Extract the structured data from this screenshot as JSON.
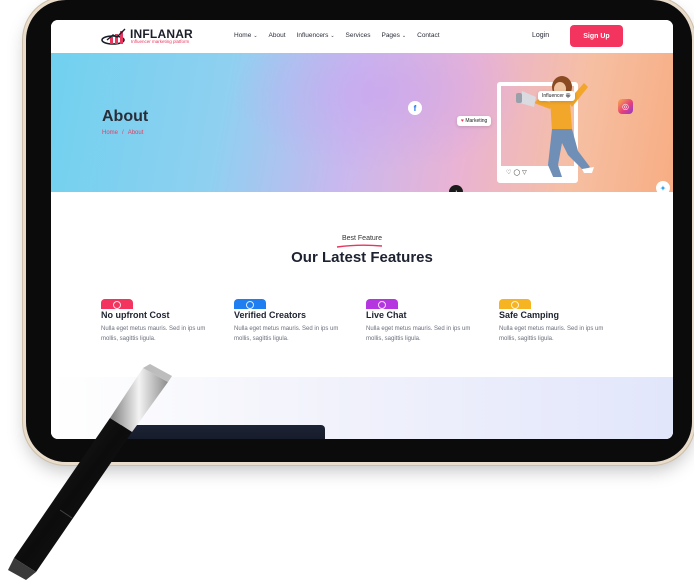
{
  "brand": {
    "name": "INFLANAR",
    "tagline": "Influencer marketing platform",
    "accent_color": "#f2345e"
  },
  "nav": {
    "items": [
      {
        "label": "Home",
        "has_dropdown": true
      },
      {
        "label": "About",
        "has_dropdown": false
      },
      {
        "label": "Influencers",
        "has_dropdown": true
      },
      {
        "label": "Services",
        "has_dropdown": false
      },
      {
        "label": "Pages",
        "has_dropdown": true
      },
      {
        "label": "Contact",
        "has_dropdown": false
      }
    ],
    "login_label": "Login",
    "signup_label": "Sign Up"
  },
  "hero": {
    "title": "About",
    "breadcrumb": {
      "home": "Home",
      "separator": "/",
      "current": "About"
    },
    "tag_influencer": "Influencer 😀",
    "tag_marketing": "Marketing",
    "social_icons": [
      "facebook-icon",
      "instagram-icon",
      "tiktok-icon",
      "twitter-icon"
    ]
  },
  "features_section": {
    "eyebrow": "Best Feature",
    "title": "Our Latest Features",
    "features": [
      {
        "title": "No upfront Cost",
        "text": "Nulla eget metus mauris. Sed in ips um mollis, sagittis ligula.",
        "color": "#f2345e",
        "icon": "dollar-icon"
      },
      {
        "title": "Verified Creators",
        "text": "Nulla eget metus mauris. Sed in ips um mollis, sagittis ligula.",
        "color": "#1f7ef0",
        "icon": "check-icon"
      },
      {
        "title": "Live Chat",
        "text": "Nulla eget metus mauris. Sed in ips um mollis, sagittis ligula.",
        "color": "#b536e0",
        "icon": "chat-icon"
      },
      {
        "title": "Safe Camping",
        "text": "Nulla eget metus mauris. Sed in ips um mollis, sagittis ligula.",
        "color": "#f6b322",
        "icon": "shield-icon"
      }
    ]
  }
}
